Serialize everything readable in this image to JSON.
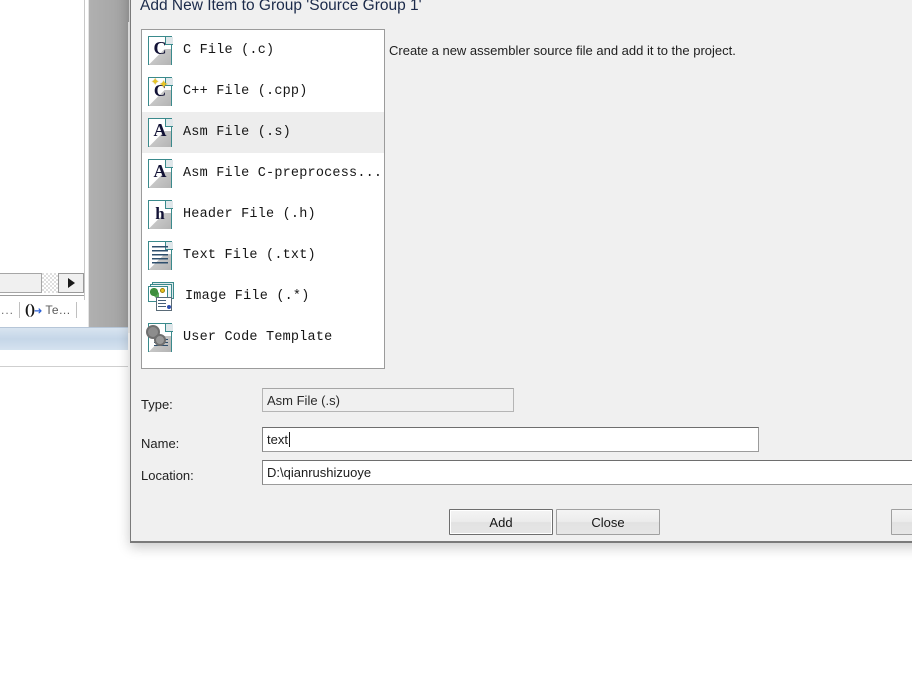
{
  "background": {
    "tab_strip": {
      "ellipsis": "...",
      "glyph": "()",
      "arrow_mark": "➜",
      "label": "Te..."
    },
    "scroll_arrow_icon": "right-arrow-icon"
  },
  "dialog": {
    "title": "Add New Item to Group 'Source Group 1'",
    "description": "Create a new assembler source file and add it to the project.",
    "item_list": [
      {
        "label": "C File (.c)",
        "icon": "c-file-icon",
        "selected": false
      },
      {
        "label": "C++ File (.cpp)",
        "icon": "cpp-file-icon",
        "selected": false
      },
      {
        "label": "Asm File (.s)",
        "icon": "asm-file-icon",
        "selected": true
      },
      {
        "label": "Asm File C-preprocess...",
        "icon": "asm-preprocess-file-icon",
        "selected": false
      },
      {
        "label": "Header File (.h)",
        "icon": "header-file-icon",
        "selected": false
      },
      {
        "label": "Text File (.txt)",
        "icon": "text-file-icon",
        "selected": false
      },
      {
        "label": "Image File (.*)",
        "icon": "image-file-icon",
        "selected": false
      },
      {
        "label": "User Code Template",
        "icon": "user-code-template-icon",
        "selected": false
      }
    ],
    "fields": {
      "type": {
        "label": "Type:",
        "value": "Asm File (.s)",
        "readonly": true
      },
      "name": {
        "label": "Name:",
        "value": "text",
        "readonly": false
      },
      "location": {
        "label": "Location:",
        "value": "D:\\qianrushizuoye",
        "readonly": false
      }
    },
    "buttons": {
      "add": "Add",
      "close": "Close",
      "help": ""
    }
  },
  "colors": {
    "dialog_background": "#f0f0f0",
    "selected_row": "#ededed",
    "title_text": "#1b2a4a",
    "icon_border": "#3a8a8c",
    "status_bar": "#c5d6e8"
  }
}
